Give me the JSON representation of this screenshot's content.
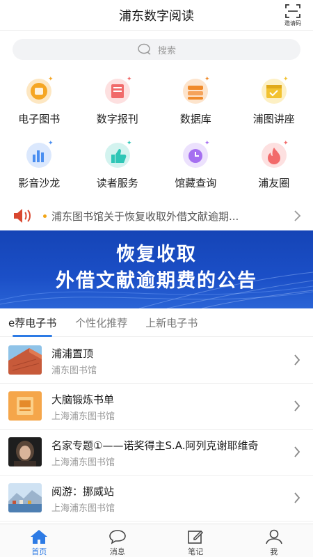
{
  "header": {
    "title": "浦东数字阅读",
    "invite_label": "邀请码"
  },
  "search": {
    "placeholder": "搜索"
  },
  "grid": [
    {
      "label": "电子图书",
      "icon": "ebook-icon",
      "color": "#f5a623"
    },
    {
      "label": "数字报刊",
      "icon": "newspaper-icon",
      "color": "#f06a6a"
    },
    {
      "label": "数据库",
      "icon": "database-icon",
      "color": "#f08a2a"
    },
    {
      "label": "浦图讲座",
      "icon": "lecture-calendar-icon",
      "color": "#f2c230"
    },
    {
      "label": "影音沙龙",
      "icon": "video-chart-icon",
      "color": "#4a8ef0"
    },
    {
      "label": "读者服务",
      "icon": "thumbs-up-icon",
      "color": "#2fc6b6"
    },
    {
      "label": "馆藏查询",
      "icon": "clock-icon",
      "color": "#a56ff0"
    },
    {
      "label": "浦友圈",
      "icon": "flame-icon",
      "color": "#f26a6a"
    }
  ],
  "notice": {
    "text": "浦东图书馆关于恢复收取外借文献逾期..."
  },
  "banner": {
    "line1": "恢复收取",
    "line2": "外借文献逾期费的公告"
  },
  "tabs": [
    {
      "label": "e荐电子书",
      "active": true
    },
    {
      "label": "个性化推荐",
      "active": false
    },
    {
      "label": "上新电子书",
      "active": false
    }
  ],
  "list": [
    {
      "title": "浦浦置顶",
      "subtitle": "浦东图书馆",
      "thumb": "building-photo"
    },
    {
      "title": "大脑锻炼书单",
      "subtitle": "上海浦东图书馆",
      "thumb": "orange-book-photo"
    },
    {
      "title": "名家专题①——诺奖得主S.A.阿列克谢耶维奇",
      "subtitle": "上海浦东图书馆",
      "thumb": "author-portrait"
    },
    {
      "title": "阅游：挪威站",
      "subtitle": "上海浦东图书馆",
      "thumb": "norway-town-photo"
    }
  ],
  "tabbar": [
    {
      "label": "首页",
      "icon": "home-icon",
      "active": true
    },
    {
      "label": "消息",
      "icon": "chat-bubble-icon",
      "active": false
    },
    {
      "label": "笔记",
      "icon": "edit-note-icon",
      "active": false
    },
    {
      "label": "我",
      "icon": "person-icon",
      "active": false
    }
  ],
  "colors": {
    "accent": "#2d7be5",
    "banner": "#1b4fc7",
    "notice_dot": "#f2a516",
    "speaker": "#d9472f"
  }
}
